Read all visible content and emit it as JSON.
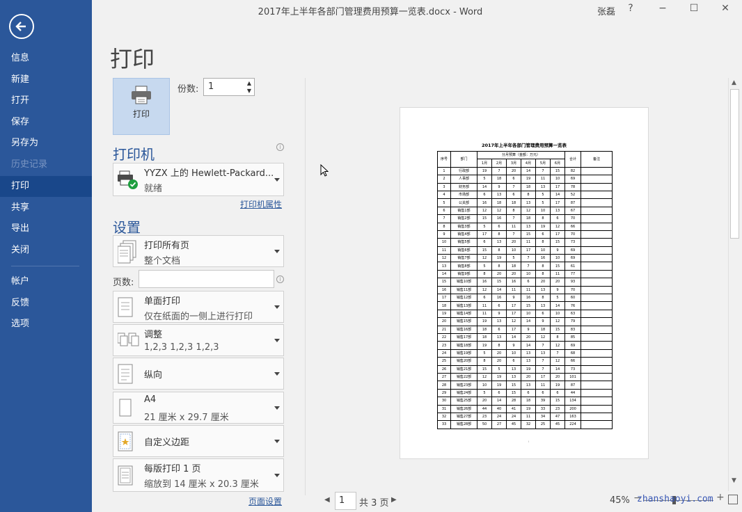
{
  "titlebar": {
    "title": "2017年上半年各部门管理费用预算一览表.docx - Word",
    "user": "张磊",
    "help": "?",
    "minimize": "−",
    "maximize": "☐",
    "close": "✕"
  },
  "nav": {
    "items": [
      {
        "label": "信息"
      },
      {
        "label": "新建"
      },
      {
        "label": "打开"
      },
      {
        "label": "保存"
      },
      {
        "label": "另存为"
      },
      {
        "label": "历史记录"
      },
      {
        "label": "打印"
      },
      {
        "label": "共享"
      },
      {
        "label": "导出"
      },
      {
        "label": "关闭"
      },
      {
        "label": "帐户"
      },
      {
        "label": "反馈"
      },
      {
        "label": "选项"
      }
    ],
    "active": "打印",
    "disabled": "历史记录"
  },
  "print": {
    "page_title": "打印",
    "print_button": "打印",
    "copies_label": "份数:",
    "copies_value": "1",
    "printer_heading": "打印机",
    "printer_name": "YYZX 上的 Hewlett-Packard...",
    "printer_status": "就绪",
    "printer_props": "打印机属性",
    "settings_heading": "设置",
    "pages_label": "页数:",
    "pages_value": "",
    "page_setup": "页面设置",
    "settings": [
      {
        "line1": "打印所有页",
        "line2": "整个文档"
      },
      {
        "line1": "单面打印",
        "line2": "仅在纸面的一侧上进行打印"
      },
      {
        "line1": "调整",
        "line2": "1,2,3    1,2,3    1,2,3"
      },
      {
        "line1": "纵向",
        "line2": ""
      },
      {
        "line1": "A4",
        "line2": "21 厘米 x 29.7 厘米"
      },
      {
        "line1": "自定义边距",
        "line2": ""
      },
      {
        "line1": "每版打印 1 页",
        "line2": "缩放到 14 厘米 x 20.3 厘米"
      }
    ]
  },
  "preview": {
    "title": "2017年上半年各部门管理费用预算一览表",
    "header_seq": "序号",
    "header_dept": "部门",
    "header_group": "分月预算（金额：万元）",
    "header_total": "合计",
    "header_note": "备注",
    "months": [
      "1月",
      "2月",
      "3月",
      "4月",
      "5月",
      "6月"
    ],
    "rows": [
      [
        "1",
        "行政部",
        "19",
        "7",
        "20",
        "14",
        "7",
        "15",
        "82"
      ],
      [
        "2",
        "人事部",
        "5",
        "18",
        "6",
        "19",
        "11",
        "10",
        "69"
      ],
      [
        "3",
        "财务部",
        "14",
        "9",
        "7",
        "18",
        "13",
        "17",
        "78"
      ],
      [
        "4",
        "市场部",
        "6",
        "13",
        "6",
        "8",
        "5",
        "14",
        "52"
      ],
      [
        "5",
        "公关部",
        "16",
        "18",
        "18",
        "13",
        "5",
        "17",
        "87"
      ],
      [
        "6",
        "销售1部",
        "12",
        "12",
        "8",
        "12",
        "10",
        "13",
        "67"
      ],
      [
        "7",
        "销售2部",
        "15",
        "16",
        "7",
        "18",
        "8",
        "6",
        "70"
      ],
      [
        "8",
        "销售3部",
        "5",
        "6",
        "11",
        "13",
        "19",
        "12",
        "66"
      ],
      [
        "9",
        "销售4部",
        "17",
        "8",
        "7",
        "15",
        "6",
        "17",
        "70"
      ],
      [
        "10",
        "销售5部",
        "6",
        "13",
        "20",
        "11",
        "8",
        "15",
        "73"
      ],
      [
        "11",
        "销售6部",
        "15",
        "8",
        "10",
        "17",
        "10",
        "9",
        "69"
      ],
      [
        "12",
        "销售7部",
        "12",
        "19",
        "5",
        "7",
        "16",
        "10",
        "69"
      ],
      [
        "13",
        "销售8部",
        "5",
        "8",
        "18",
        "7",
        "8",
        "15",
        "61"
      ],
      [
        "14",
        "销售9部",
        "8",
        "20",
        "20",
        "10",
        "8",
        "11",
        "77"
      ],
      [
        "15",
        "销售10部",
        "16",
        "15",
        "16",
        "6",
        "20",
        "20",
        "93"
      ],
      [
        "16",
        "销售11部",
        "12",
        "14",
        "11",
        "11",
        "13",
        "9",
        "70"
      ],
      [
        "17",
        "销售12部",
        "6",
        "16",
        "9",
        "16",
        "8",
        "5",
        "60"
      ],
      [
        "18",
        "销售13部",
        "11",
        "6",
        "17",
        "15",
        "13",
        "14",
        "76"
      ],
      [
        "19",
        "销售14部",
        "11",
        "9",
        "17",
        "10",
        "6",
        "10",
        "63"
      ],
      [
        "20",
        "销售15部",
        "19",
        "13",
        "12",
        "14",
        "9",
        "12",
        "79"
      ],
      [
        "21",
        "销售16部",
        "18",
        "6",
        "17",
        "9",
        "18",
        "15",
        "83"
      ],
      [
        "22",
        "销售17部",
        "18",
        "13",
        "14",
        "20",
        "12",
        "8",
        "85"
      ],
      [
        "23",
        "销售18部",
        "19",
        "8",
        "9",
        "14",
        "7",
        "12",
        "69"
      ],
      [
        "24",
        "销售19部",
        "5",
        "20",
        "10",
        "13",
        "13",
        "7",
        "68"
      ],
      [
        "25",
        "销售20部",
        "8",
        "20",
        "6",
        "13",
        "7",
        "12",
        "66"
      ],
      [
        "26",
        "销售21部",
        "15",
        "5",
        "13",
        "19",
        "7",
        "14",
        "73"
      ],
      [
        "27",
        "销售22部",
        "12",
        "19",
        "13",
        "20",
        "17",
        "20",
        "101"
      ],
      [
        "28",
        "销售23部",
        "10",
        "19",
        "15",
        "13",
        "11",
        "19",
        "87"
      ],
      [
        "29",
        "销售24部",
        "5",
        "6",
        "15",
        "6",
        "6",
        "6",
        "44"
      ],
      [
        "30",
        "销售25部",
        "20",
        "14",
        "28",
        "18",
        "39",
        "15",
        "134"
      ],
      [
        "31",
        "销售26部",
        "44",
        "40",
        "41",
        "19",
        "33",
        "23",
        "200"
      ],
      [
        "32",
        "销售27部",
        "23",
        "24",
        "24",
        "11",
        "34",
        "47",
        "163"
      ],
      [
        "33",
        "销售28部",
        "50",
        "27",
        "45",
        "32",
        "25",
        "45",
        "224"
      ]
    ],
    "page_current": "1",
    "page_total": "共 3 页",
    "zoom": "45%"
  },
  "watermark": "zhanshaoyi.com"
}
